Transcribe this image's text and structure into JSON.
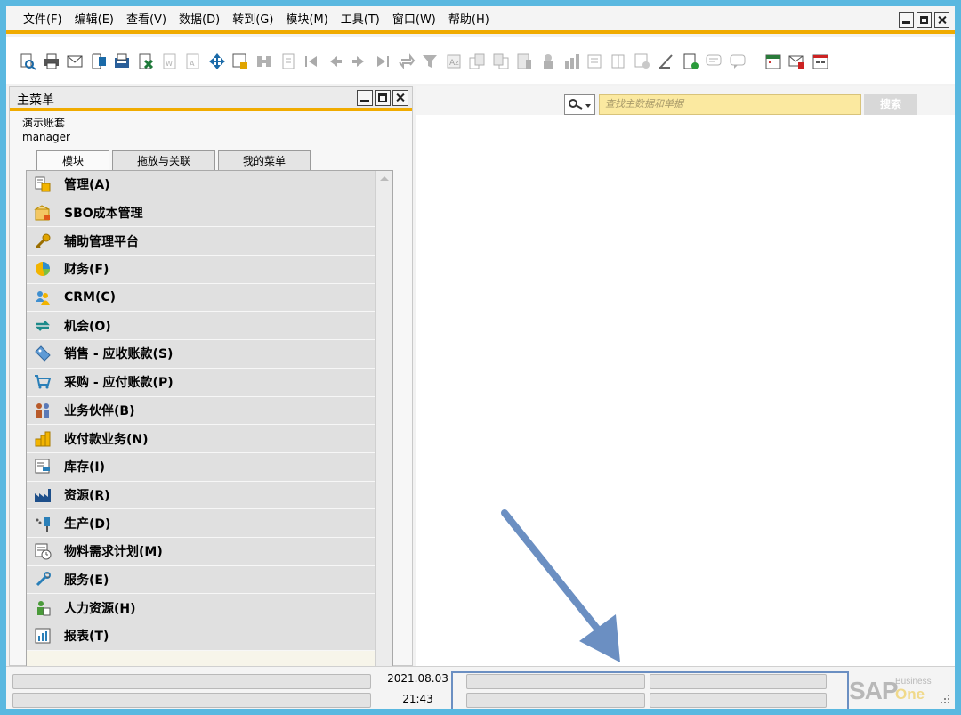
{
  "menubar": {
    "items": [
      "文件(F)",
      "编辑(E)",
      "查看(V)",
      "数据(D)",
      "转到(G)",
      "模块(M)",
      "工具(T)",
      "窗口(W)",
      "帮助(H)"
    ]
  },
  "toolbar": {
    "icons": [
      {
        "name": "preview-icon",
        "enabled": true
      },
      {
        "name": "print-icon",
        "enabled": true
      },
      {
        "name": "email-icon",
        "enabled": true
      },
      {
        "name": "sms-icon",
        "enabled": true
      },
      {
        "name": "fax-icon",
        "enabled": true
      },
      {
        "name": "excel-export-icon",
        "enabled": true
      },
      {
        "name": "word-export-icon",
        "enabled": false
      },
      {
        "name": "pdf-export-icon",
        "enabled": false
      },
      {
        "name": "move-icon",
        "enabled": true
      },
      {
        "name": "lock-form-icon",
        "enabled": true
      },
      {
        "name": "find-icon",
        "enabled": false
      },
      {
        "name": "add-icon",
        "enabled": false
      },
      {
        "name": "first-record-icon",
        "enabled": false
      },
      {
        "name": "previous-record-icon",
        "enabled": false
      },
      {
        "name": "next-record-icon",
        "enabled": false
      },
      {
        "name": "last-record-icon",
        "enabled": false
      },
      {
        "name": "refresh-icon",
        "enabled": false
      },
      {
        "name": "filter-icon",
        "enabled": false
      },
      {
        "name": "sort-icon",
        "enabled": false
      },
      {
        "name": "base-document-icon",
        "enabled": false
      },
      {
        "name": "target-document-icon",
        "enabled": false
      },
      {
        "name": "journal-icon",
        "enabled": false
      },
      {
        "name": "payment-means-icon",
        "enabled": false
      },
      {
        "name": "gross-profit-icon",
        "enabled": false
      },
      {
        "name": "volume-weight-icon",
        "enabled": false
      },
      {
        "name": "layout-designer-icon",
        "enabled": false
      },
      {
        "name": "form-settings-icon",
        "enabled": false
      },
      {
        "name": "document-settings-icon",
        "enabled": true
      },
      {
        "name": "query-manager-icon",
        "enabled": true
      },
      {
        "name": "messages-icon",
        "enabled": false
      },
      {
        "name": "alerts-icon",
        "enabled": false
      },
      {
        "name": "calendar-icon",
        "enabled": true
      },
      {
        "name": "inbox-icon",
        "enabled": true
      },
      {
        "name": "cockpit-icon",
        "enabled": true
      }
    ]
  },
  "main_menu": {
    "title": "主菜单",
    "company": "演示账套",
    "user": "manager",
    "tabs": [
      "模块",
      "拖放与关联",
      "我的菜单"
    ],
    "modules": [
      {
        "label": "管理(A)",
        "icon": "administration-icon"
      },
      {
        "label": "SBO成本管理",
        "icon": "cost-management-icon"
      },
      {
        "label": "辅助管理平台",
        "icon": "key-icon"
      },
      {
        "label": "财务(F)",
        "icon": "financials-pie-icon"
      },
      {
        "label": "CRM(C)",
        "icon": "crm-people-icon"
      },
      {
        "label": "机会(O)",
        "icon": "opportunities-icon"
      },
      {
        "label": "销售 - 应收账款(S)",
        "icon": "sales-tag-icon"
      },
      {
        "label": "采购 - 应付账款(P)",
        "icon": "shopping-cart-icon"
      },
      {
        "label": "业务伙伴(B)",
        "icon": "business-partners-icon"
      },
      {
        "label": "收付款业务(N)",
        "icon": "banking-coins-icon"
      },
      {
        "label": "库存(I)",
        "icon": "inventory-icon"
      },
      {
        "label": "资源(R)",
        "icon": "factory-icon"
      },
      {
        "label": "生产(D)",
        "icon": "production-icon"
      },
      {
        "label": "物料需求计划(M)",
        "icon": "mrp-calendar-icon"
      },
      {
        "label": "服务(E)",
        "icon": "service-wrench-icon"
      },
      {
        "label": "人力资源(H)",
        "icon": "human-resources-icon"
      },
      {
        "label": "报表(T)",
        "icon": "reports-chart-icon"
      }
    ]
  },
  "search": {
    "placeholder": "查找主数据和单据",
    "button_label": "搜索"
  },
  "statusbar": {
    "date": "2021.08.03",
    "time": "21:43"
  },
  "brand": {
    "sap": "SAP",
    "business": "Business",
    "one": "One"
  },
  "colors": {
    "accent": "#f0ab00",
    "highlight_border": "#6b8fc2",
    "arrow": "#6b8fc2",
    "search_bg": "#fbe9a0"
  }
}
